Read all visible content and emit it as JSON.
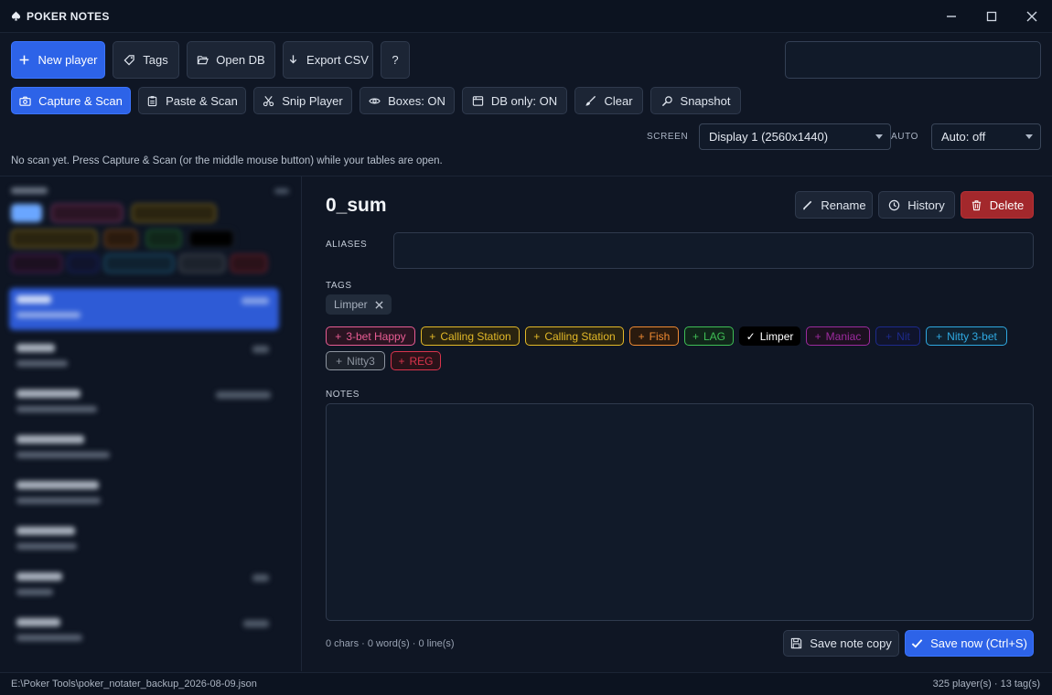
{
  "app": {
    "title": "POKER NOTES"
  },
  "toolbar1": {
    "new_player": "New player",
    "tags": "Tags",
    "open_db": "Open DB",
    "export_csv": "Export CSV",
    "help": "?"
  },
  "toolbar2": {
    "capture_scan": "Capture & Scan",
    "paste_scan": "Paste & Scan",
    "snip_player": "Snip Player",
    "boxes": "Boxes: ON",
    "db_only": "DB only: ON",
    "clear": "Clear",
    "snapshot": "Snapshot"
  },
  "screen": {
    "label": "SCREEN",
    "value": "Display 1  (2560x1440)"
  },
  "auto": {
    "label": "AUTO",
    "value": "Auto: off"
  },
  "status": "No scan yet. Press Capture & Scan (or the middle mouse button) while your tables are open.",
  "player": {
    "name": "0_sum",
    "rename": "Rename",
    "history": "History",
    "delete": "Delete",
    "aliases_label": "ALIASES",
    "tags_label": "TAGS",
    "assigned_tag": "Limper",
    "notes_label": "NOTES",
    "counts": "0 chars · 0 word(s) · 0 line(s)",
    "save_copy": "Save note copy",
    "save_now": "Save now (Ctrl+S)"
  },
  "tag_options": [
    {
      "label": "3-bet Happy",
      "color": "#e85c93",
      "bg": "#2a1422",
      "state": "add"
    },
    {
      "label": "Calling Station",
      "color": "#e3b928",
      "bg": "#2a2410",
      "state": "add"
    },
    {
      "label": "Calling Station",
      "color": "#e3b928",
      "bg": "#2a2410",
      "state": "add"
    },
    {
      "label": "Fish",
      "color": "#ef8a32",
      "bg": "#2a1a0e",
      "state": "add"
    },
    {
      "label": "LAG",
      "color": "#3fbf55",
      "bg": "#10261a",
      "state": "add"
    },
    {
      "label": "Limper",
      "color": "#ffffff",
      "bg": "#000000",
      "state": "selected"
    },
    {
      "label": "Maniac",
      "color": "#9c2a9e",
      "bg": "#1c1020",
      "state": "add"
    },
    {
      "label": "Nit",
      "color": "#1d2a8c",
      "bg": "#10142c",
      "state": "add"
    },
    {
      "label": "Nitty 3-bet",
      "color": "#2fa8e0",
      "bg": "#0f2130",
      "state": "add"
    },
    {
      "label": "Nitty3",
      "color": "#8d949f",
      "bg": "#1c222c",
      "state": "add"
    },
    {
      "label": "REG",
      "color": "#d8344c",
      "bg": "#2a1219",
      "state": "add"
    }
  ],
  "footer": {
    "path": "E:\\Poker Tools\\poker_notater_backup_2026-08-09.json",
    "summary": "325 player(s)  ·  13 tag(s)"
  }
}
